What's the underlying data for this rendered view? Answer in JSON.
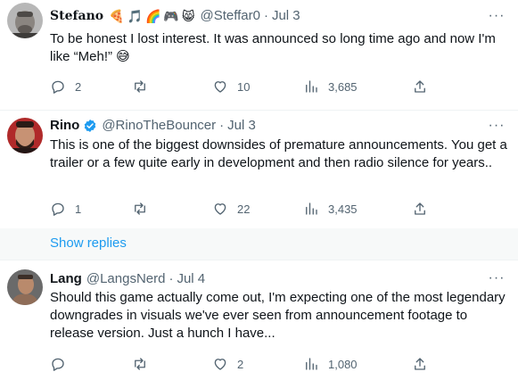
{
  "tweets": [
    {
      "name": "Stefano",
      "emojis": [
        "🍕",
        "🎵",
        "🌈",
        "🎮",
        "😸"
      ],
      "handle": "@Steffar0",
      "dot": "·",
      "date": "Jul 3",
      "text": "To be honest I lost interest. It was announced so long time ago and now I'm like “Meh!” 😅",
      "replies": "2",
      "retweets": "",
      "likes": "10",
      "views": "3,685"
    },
    {
      "name": "Rino",
      "verified": true,
      "handle": "@RinoTheBouncer",
      "dot": "·",
      "date": "Jul 3",
      "text": "This is one of the biggest downsides of premature announcements. You get a trailer or a few quite early in development and then radio silence for years..",
      "replies": "1",
      "retweets": "",
      "likes": "22",
      "views": "3,435"
    },
    {
      "name": "Lang",
      "handle": "@LangsNerd",
      "dot": "·",
      "date": "Jul 4",
      "text": "Should this game actually come out, I'm expecting one of the most legendary downgrades in visuals we've ever seen from announcement footage to release version. Just a hunch I have...",
      "replies": "",
      "retweets": "",
      "likes": "2",
      "views": "1,080"
    }
  ],
  "show_replies_label": "Show replies",
  "more_glyph": "···",
  "colors": {
    "text": "#0f1419",
    "secondary": "#536471",
    "link": "#1d9bf0",
    "verified": "#1d9bf0",
    "divider": "#eff3f4"
  },
  "icons": [
    "reply-icon",
    "retweet-icon",
    "like-icon",
    "views-icon",
    "share-icon",
    "verified-badge-icon",
    "more-icon"
  ]
}
